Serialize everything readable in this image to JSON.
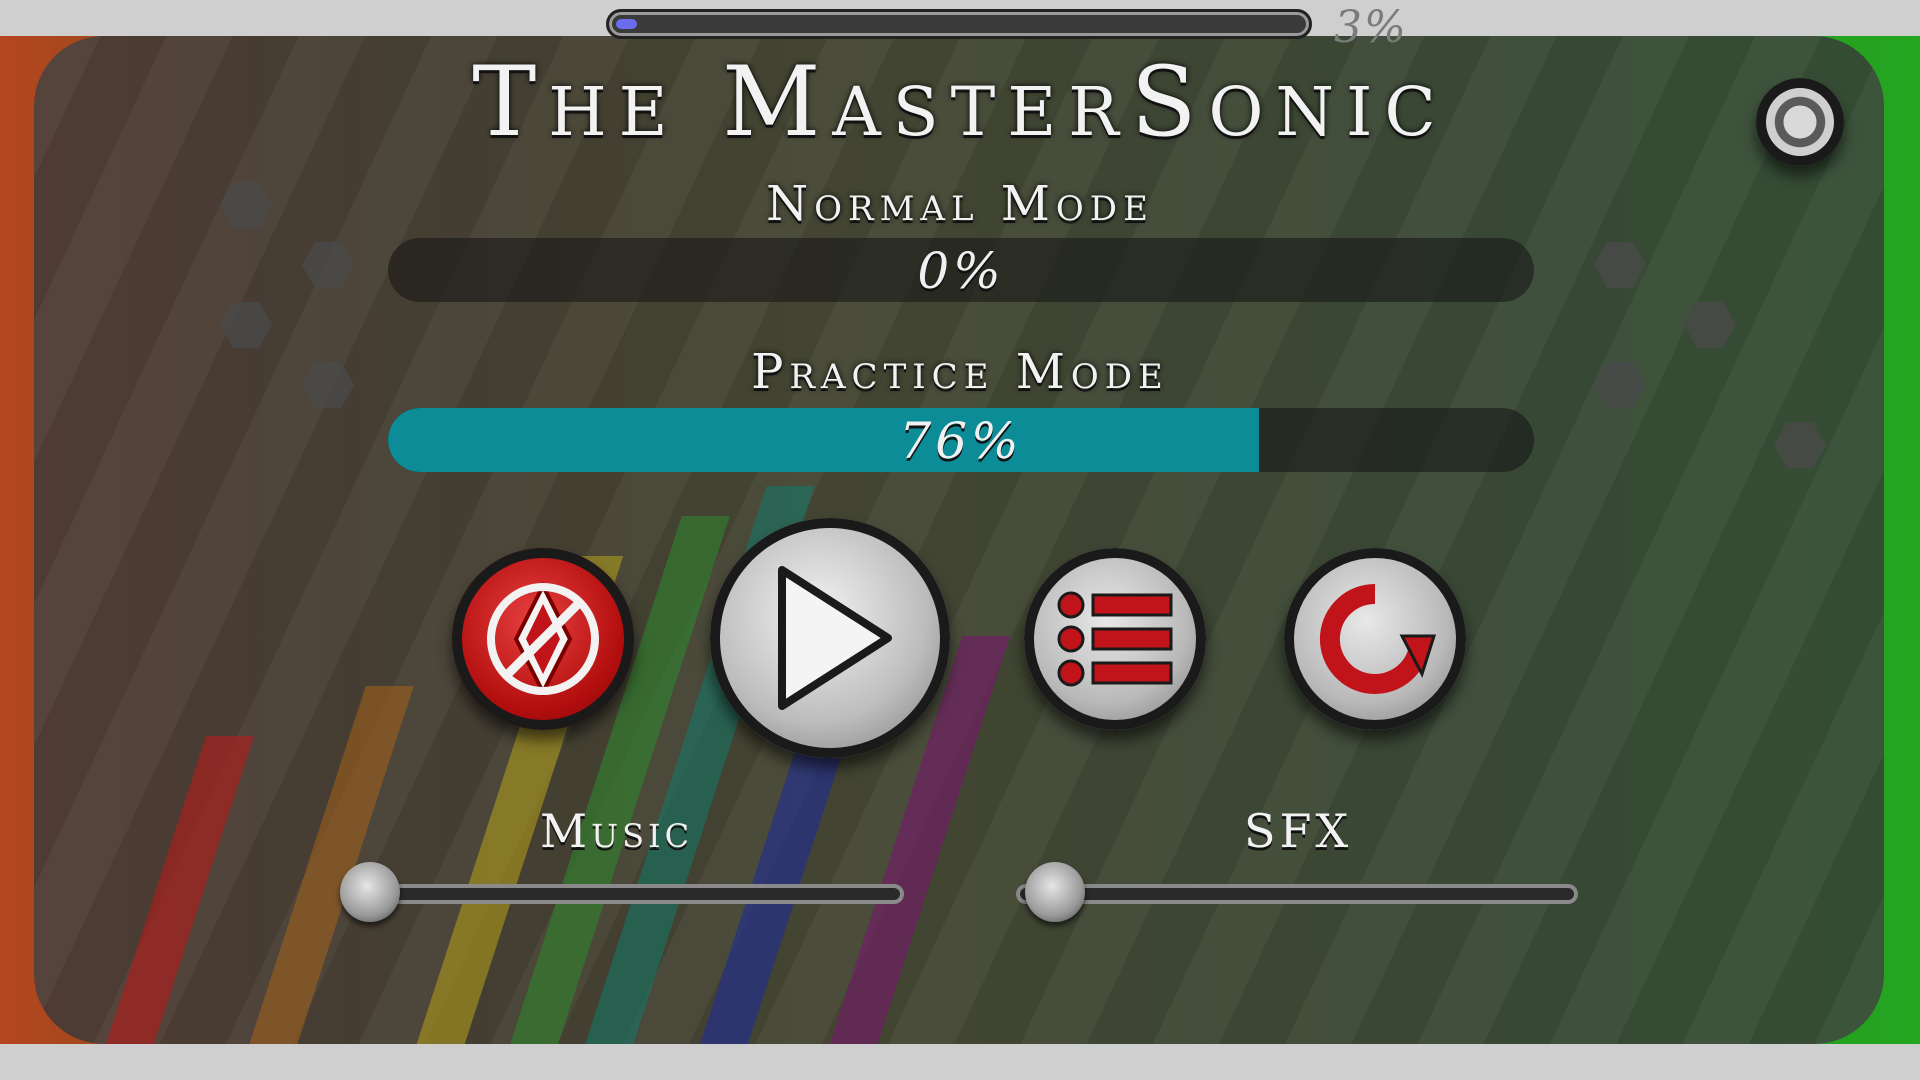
{
  "level": {
    "title": "The MasterSonic",
    "progress_percent": 3,
    "progress_text": "3%"
  },
  "modes": {
    "normal": {
      "label": "Normal Mode",
      "percent": 0,
      "percent_text": "0%"
    },
    "practice": {
      "label": "Practice Mode",
      "percent": 76,
      "percent_text": "76%"
    }
  },
  "buttons": {
    "practice": {
      "icon": "practice-diamond-icon",
      "color": "#c0141a"
    },
    "play": {
      "icon": "play-icon"
    },
    "menu": {
      "icon": "menu-list-icon"
    },
    "restart": {
      "icon": "restart-icon"
    },
    "settings": {
      "icon": "gear-icon"
    }
  },
  "audio": {
    "music": {
      "label": "Music",
      "level": 0.05
    },
    "sfx": {
      "label": "SFX",
      "level": 0.07
    }
  },
  "colors": {
    "practice_bar": "#0b8c97",
    "progress_fill": "#6a6cf0",
    "accent_red": "#c0141a"
  }
}
